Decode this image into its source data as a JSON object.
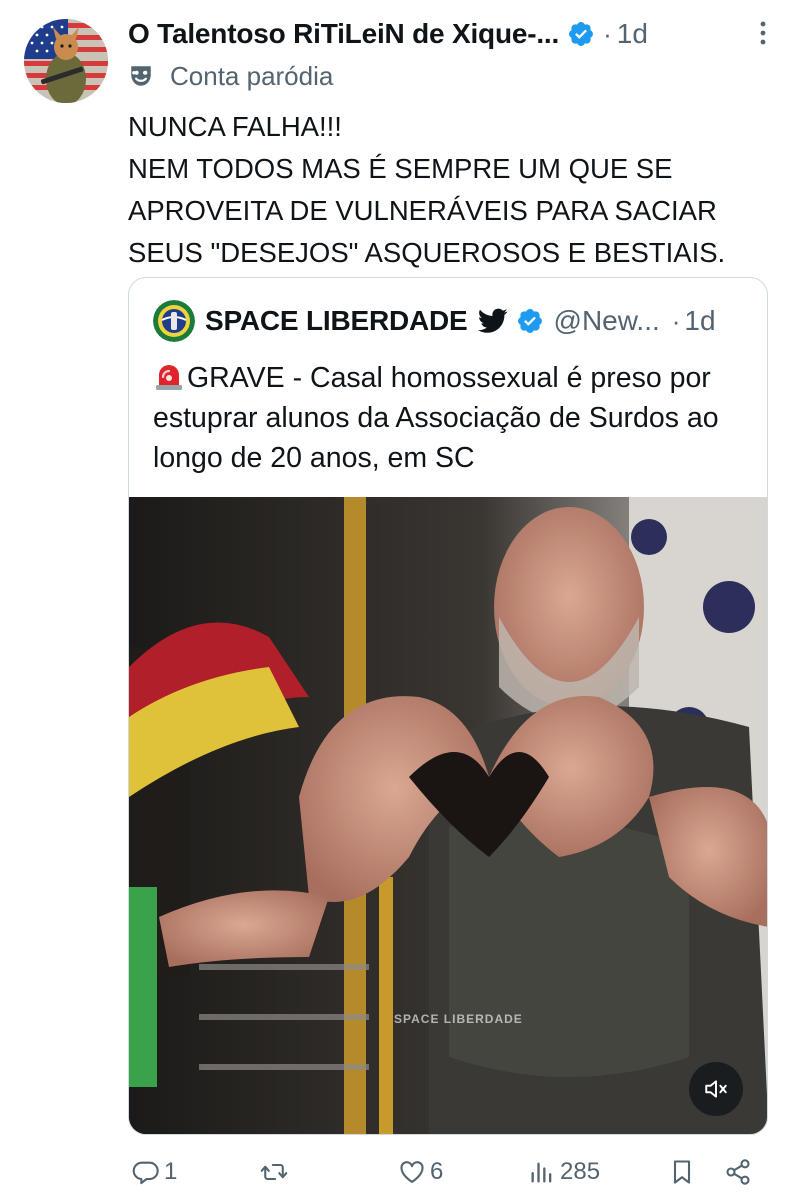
{
  "author": {
    "name": "O Talentoso RiTiLeiN de Xique-...",
    "time": "1d",
    "label": "Conta paródia"
  },
  "post": {
    "text": "NUNCA FALHA!!!\nNEM TODOS MAS É SEMPRE UM QUE SE APROVEITA DE VULNERÁVEIS PARA SACIAR SEUS \"DESEJOS\" ASQUEROSOS E BESTIAIS."
  },
  "quote": {
    "name": "SPACE LIBERDADE",
    "handle": "@New...",
    "time": "1d",
    "text": "GRAVE - Casal homossexual é preso por estuprar alunos da Associação de Surdos ao longo de 20 anos, em SC"
  },
  "media": {
    "watermark": "SPACE LIBERDADE"
  },
  "actions": {
    "replies": "1",
    "reposts": "",
    "likes": "6",
    "views": "285"
  },
  "colors": {
    "verified": "#1d9bf0",
    "muted_text": "#536471",
    "border": "#cfd9de"
  },
  "icons": [
    "verified-badge-icon",
    "more-icon",
    "parody-mask-icon",
    "twitter-bird-icon",
    "siren-emoji-icon",
    "mute-icon",
    "reply-icon",
    "repost-icon",
    "like-icon",
    "views-icon",
    "bookmark-icon",
    "share-icon"
  ]
}
